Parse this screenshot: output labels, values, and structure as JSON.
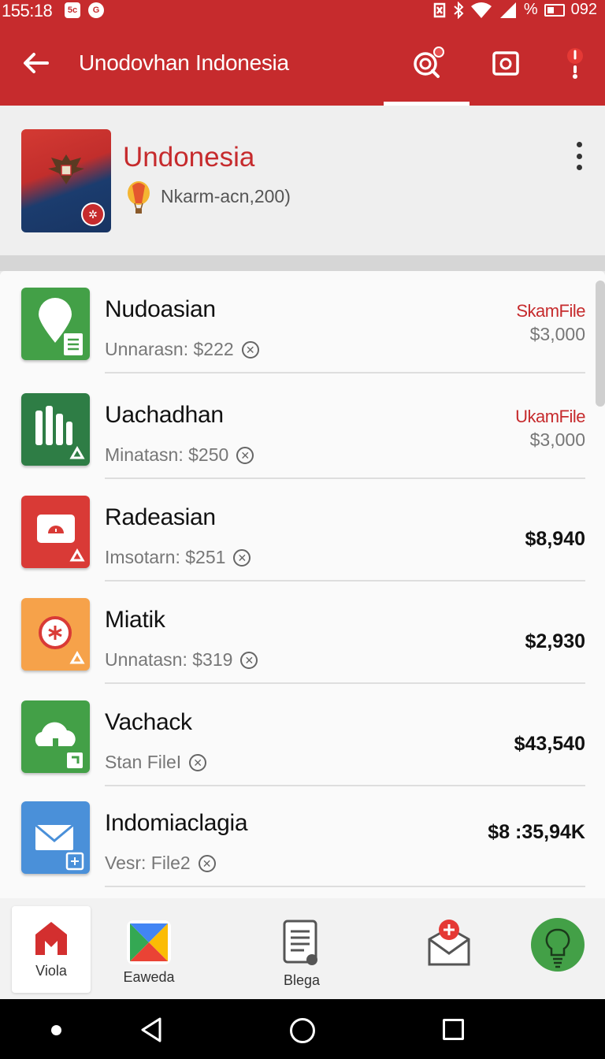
{
  "status_bar": {
    "time": "155:18",
    "right_text": "% ",
    "right_number": "092",
    "icons": [
      "notification-box-icon",
      "google-icon",
      "nfc-icon",
      "bluetooth-icon",
      "wifi-icon",
      "signal-icon",
      "battery-icon"
    ]
  },
  "app_bar": {
    "title": "Unodovhan Indonesia",
    "icons": [
      "back-arrow-icon",
      "search-badge-icon",
      "media-icon",
      "alert-icon"
    ],
    "active_tab_index": 0
  },
  "header": {
    "title": "Undonesia",
    "subtitle": "Nkarm-acn,200)"
  },
  "list": {
    "items": [
      {
        "title": "Nudoasian",
        "subtitle": "Unnarasn: $222",
        "tag": "SkamFile",
        "amount": "$3,000",
        "icon": "map-pin-doc-icon",
        "color": "#43a047"
      },
      {
        "title": "Uachadhan",
        "subtitle": "Minatasn: $250",
        "tag": "UkamFile",
        "amount": "$3,000",
        "icon": "bar-chart-icon",
        "color": "#2e7d45"
      },
      {
        "title": "Radeasian",
        "subtitle": "Imsotarn: $251",
        "tag": "",
        "amount": "$8,940",
        "icon": "monitor-alert-icon",
        "color": "#d93a36"
      },
      {
        "title": "Miatik",
        "subtitle": "Unnatasn: $319",
        "tag": "",
        "amount": "$2,930",
        "icon": "asterisk-circle-icon",
        "color": "#f6a24a"
      },
      {
        "title": "Vachack",
        "subtitle": "Stan FileI",
        "tag": "",
        "amount": "$43,540",
        "icon": "tree-cloud-icon",
        "color": "#43a047"
      },
      {
        "title": "Indomiaclagia",
        "subtitle": "Vesr: File2",
        "tag": "",
        "amount": "$8 :35,94K",
        "icon": "mail-icon",
        "color": "#4a90d9"
      }
    ]
  },
  "bottom_nav": {
    "items": [
      {
        "label": "Viola",
        "icon": "home-icon",
        "active": true
      },
      {
        "label": "Eaweda",
        "icon": "play-store-icon",
        "active": false
      },
      {
        "label": "Blega",
        "icon": "document-list-icon",
        "active": false
      },
      {
        "label": "",
        "icon": "mail-add-icon",
        "active": false
      },
      {
        "label": "",
        "icon": "lightbulb-icon",
        "active": false
      }
    ]
  },
  "colors": {
    "primary": "#c62b2d",
    "text": "#111111",
    "muted": "#777777"
  }
}
